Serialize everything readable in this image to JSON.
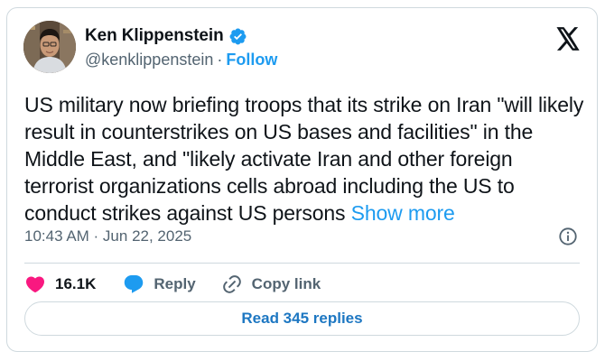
{
  "author": {
    "display_name": "Ken Klippenstein",
    "handle": "@kenklippenstein",
    "separator": "·",
    "follow_label": "Follow",
    "verified_icon": "verified-badge-icon",
    "avatar_icon": "profile-photo"
  },
  "platform": {
    "logo_icon": "x-logo-icon"
  },
  "tweet": {
    "text": "US military now briefing troops that its strike on Iran \"will likely result in counterstrikes on US bases and facilities\" in the Middle East, and \"likely activate Iran and other foreign terrorist organizations cells abroad including the US to conduct strikes against US persons ",
    "show_more_label": "Show more",
    "timestamp": "10:43 AM · Jun 22, 2025",
    "info_icon": "info-icon"
  },
  "actions": {
    "like_count": "16.1K",
    "like_icon": "heart-icon",
    "reply_label": "Reply",
    "reply_icon": "reply-bubble-icon",
    "copy_label": "Copy link",
    "copy_icon": "link-icon"
  },
  "footer": {
    "read_replies_label": "Read 345 replies"
  },
  "colors": {
    "accent": "#1d9bf0",
    "like": "#f91880",
    "secondary_text": "#536471",
    "border": "#cfd9de"
  }
}
